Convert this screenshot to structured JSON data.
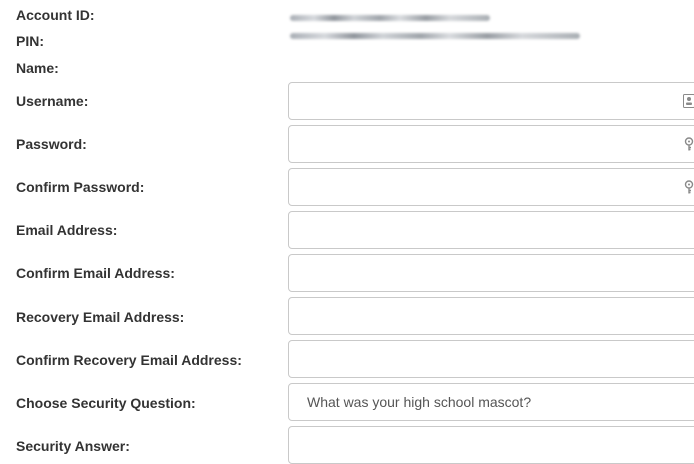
{
  "account": {
    "id_label": "Account ID:",
    "pin_label": "PIN:",
    "name_label": "Name:"
  },
  "form": {
    "username_label": "Username:",
    "password_label": "Password:",
    "confirm_password_label": "Confirm Password:",
    "email_label": "Email Address:",
    "confirm_email_label": "Confirm Email Address:",
    "recovery_email_label": "Recovery Email Address:",
    "confirm_recovery_email_label": "Confirm Recovery Email Address:",
    "security_question_label": "Choose Security Question:",
    "security_question_value": "What was your high school mascot?",
    "security_answer_label": "Security Answer:",
    "username_value": "",
    "password_value": "",
    "confirm_password_value": "",
    "email_value": "",
    "confirm_email_value": "",
    "recovery_email_value": "",
    "confirm_recovery_email_value": "",
    "security_answer_value": ""
  },
  "icons": {
    "username_icon": "contact-card-icon",
    "password_icon": "key-icon",
    "confirm_password_icon": "key-icon"
  }
}
